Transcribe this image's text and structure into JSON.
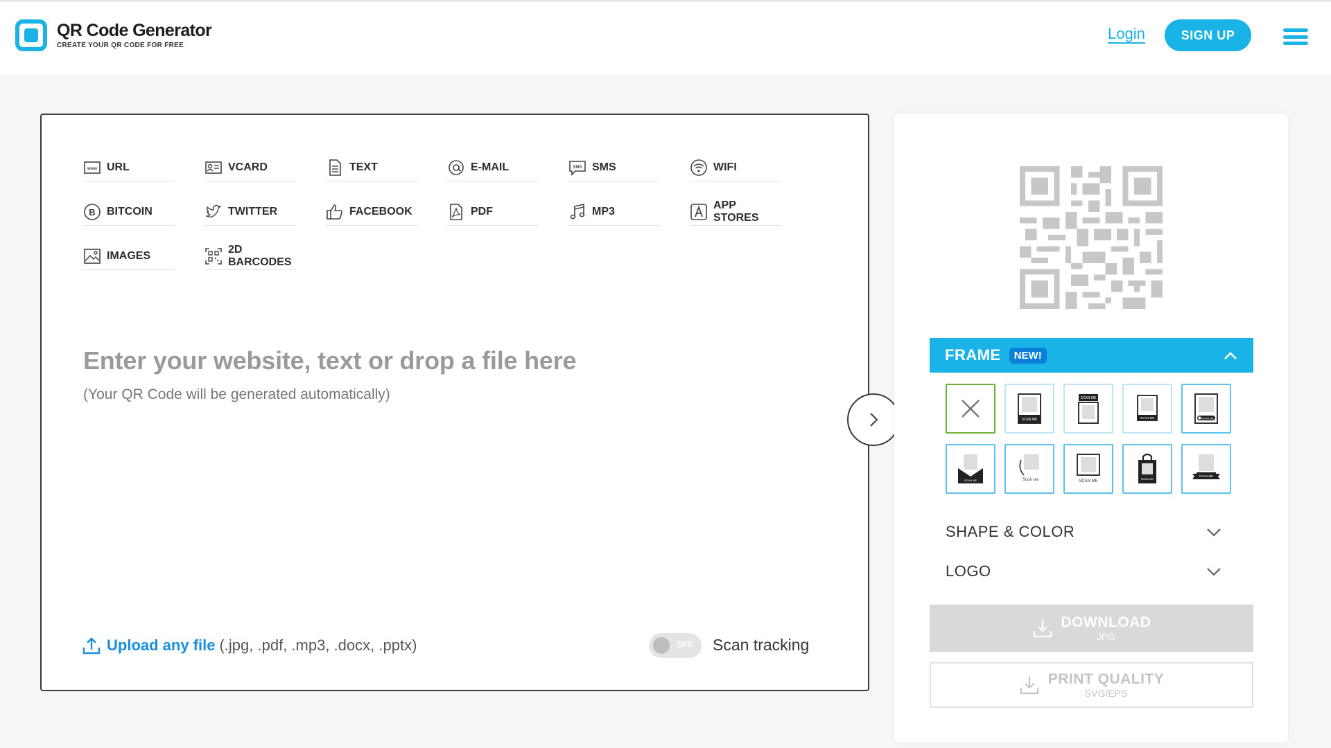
{
  "header": {
    "logo_title": "QR Code Generator",
    "logo_subtitle": "CREATE YOUR QR CODE FOR FREE",
    "login_label": "Login",
    "signup_label": "SIGN UP",
    "menu_icon": "hamburger-menu-icon"
  },
  "types": [
    {
      "label": "URL",
      "icon": "url-icon"
    },
    {
      "label": "VCARD",
      "icon": "vcard-icon"
    },
    {
      "label": "TEXT",
      "icon": "text-document-icon"
    },
    {
      "label": "E-MAIL",
      "icon": "at-sign-icon"
    },
    {
      "label": "SMS",
      "icon": "sms-icon"
    },
    {
      "label": "WIFI",
      "icon": "wifi-icon"
    },
    {
      "label": "BITCOIN",
      "icon": "bitcoin-icon"
    },
    {
      "label": "TWITTER",
      "icon": "twitter-icon"
    },
    {
      "label": "FACEBOOK",
      "icon": "thumbs-up-icon"
    },
    {
      "label": "PDF",
      "icon": "pdf-icon"
    },
    {
      "label": "MP3",
      "icon": "music-note-icon"
    },
    {
      "label": "APP STORES",
      "icon": "app-store-icon"
    },
    {
      "label": "IMAGES",
      "icon": "image-icon"
    },
    {
      "label": "2D BARCODES",
      "icon": "barcode-icon"
    }
  ],
  "input": {
    "placeholder": "Enter your website, text or drop a file here",
    "subtext": "(Your QR Code will be generated automatically)"
  },
  "upload": {
    "link_label": "Upload any file",
    "formats": "(.jpg, .pdf, .mp3, .docx, .pptx)"
  },
  "scan_tracking": {
    "state_label": "OFF",
    "label": "Scan tracking",
    "enabled": false
  },
  "frame": {
    "title": "FRAME",
    "badge": "NEW!",
    "expanded": true,
    "options": [
      {
        "name": "no-frame",
        "selected": true,
        "caption": ""
      },
      {
        "name": "frame-scan-me-bottom",
        "selected": false,
        "caption": "SCAN ME"
      },
      {
        "name": "frame-scan-me-top",
        "selected": false,
        "caption": "SCAN ME"
      },
      {
        "name": "frame-scan-me-small",
        "selected": false,
        "caption": "SCAN ME"
      },
      {
        "name": "frame-scan-me-pill",
        "selected": false,
        "caption": "SCAN ME"
      },
      {
        "name": "frame-envelope",
        "selected": false,
        "caption": "SCAN ME"
      },
      {
        "name": "frame-handwritten",
        "selected": false,
        "caption": "Scan me"
      },
      {
        "name": "frame-scan-me-label",
        "selected": false,
        "caption": "SCAN ME"
      },
      {
        "name": "frame-shopping-bag",
        "selected": false,
        "caption": "SCAN ME"
      },
      {
        "name": "frame-ribbon",
        "selected": false,
        "caption": "SCAN ME"
      }
    ]
  },
  "shape_color": {
    "label": "SHAPE & COLOR"
  },
  "logo_section": {
    "label": "LOGO"
  },
  "download": {
    "label": "DOWNLOAD",
    "format": "JPG"
  },
  "print_quality": {
    "label": "PRINT QUALITY",
    "format": "SVG/EPS"
  },
  "colors": {
    "accent": "#1ab3e8",
    "badge": "#0e7fd6",
    "selected_frame_border": "#6fb03a",
    "upload_link": "#1a8fe0",
    "download_disabled": "#d9d9d9"
  }
}
